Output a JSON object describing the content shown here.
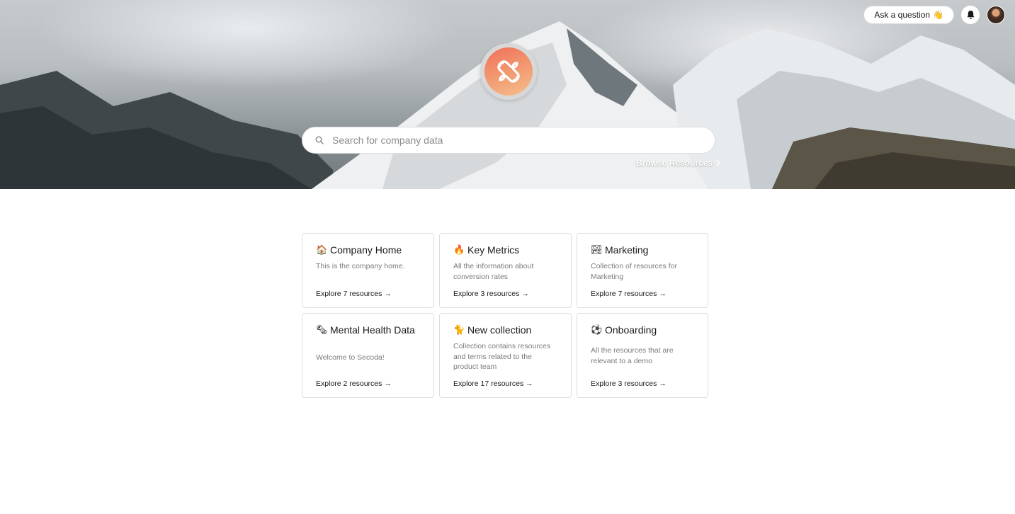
{
  "header": {
    "ask_label": "Ask a question",
    "ask_emoji": "👋",
    "bell_icon": "bell-icon",
    "avatar_icon": "user-avatar"
  },
  "logo": {
    "icon": "secoda-logo",
    "color_from": "#f0705a",
    "color_to": "#f6c08f"
  },
  "search": {
    "placeholder": "Search for company data"
  },
  "browse": {
    "label": "Browse Resources",
    "icon": "chevron-right-icon"
  },
  "collections": [
    {
      "emoji": "🏠",
      "title": "Company Home",
      "description": "This is the company home.",
      "link": "Explore 7 resources →"
    },
    {
      "emoji": "🔥",
      "title": "Key Metrics",
      "description": "All the information about conversion rates",
      "link": "Explore 3 resources →"
    },
    {
      "emoji": "🏞",
      "title": "Marketing",
      "description": "Collection of resources for Marketing",
      "link": "Explore 7 resources →"
    },
    {
      "emoji": "🗞",
      "title": "Mental Health Data",
      "description": "Welcome to Secoda!",
      "link": "Explore 2 resources →"
    },
    {
      "emoji": "🐈",
      "title": "New collection",
      "description": "Collection contains resources and terms related to the product team",
      "link": "Explore 17 resources →"
    },
    {
      "emoji": "⚽",
      "title": "Onboarding",
      "description": "All the resources that are relevant to a demo",
      "link": "Explore 3 resources →"
    }
  ]
}
